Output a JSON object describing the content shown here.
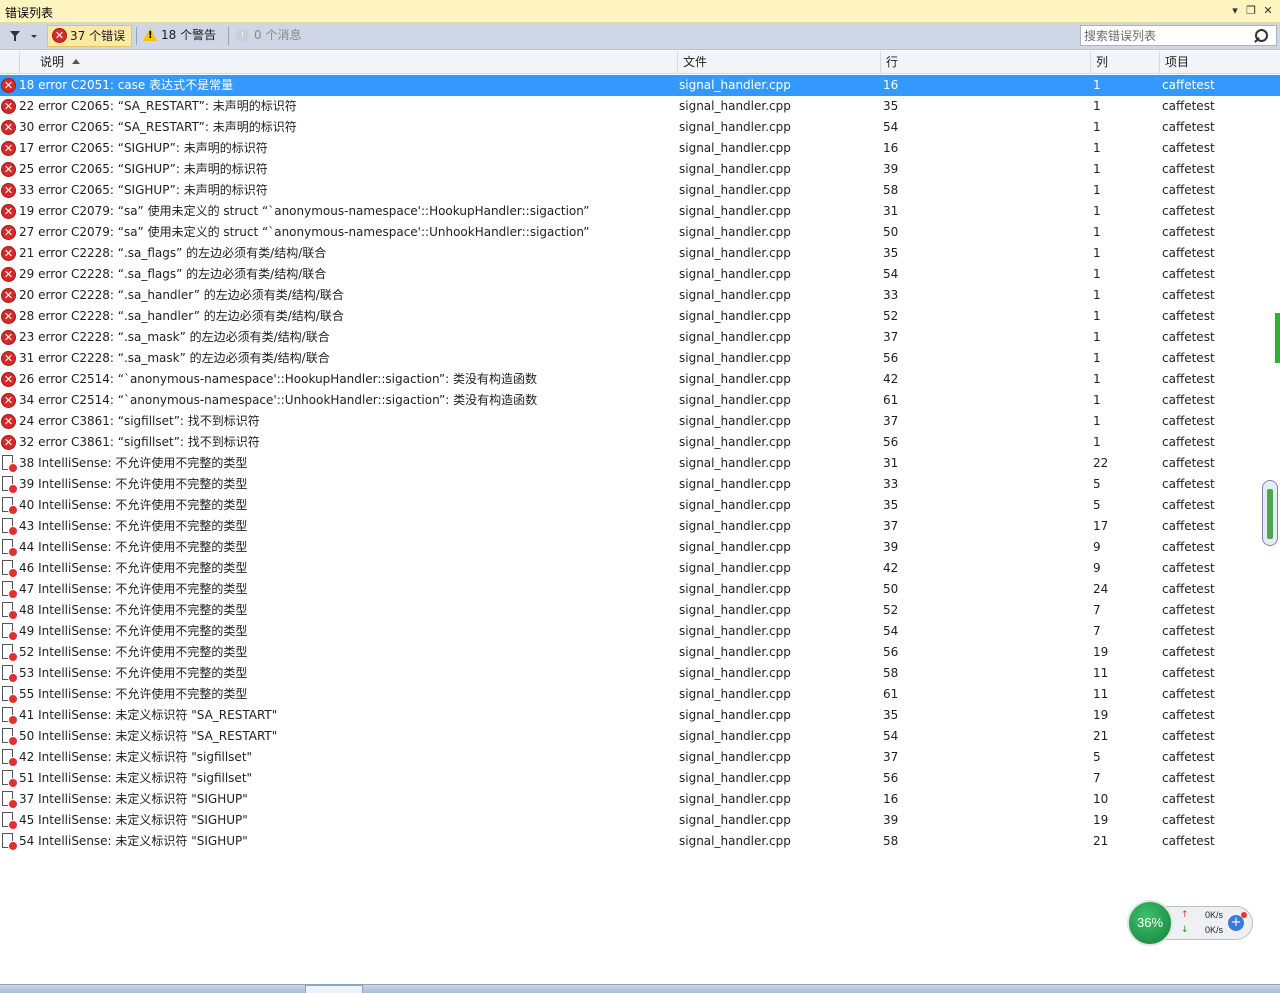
{
  "window": {
    "title": "错误列表"
  },
  "toolbar": {
    "errors_label": "37 个错误",
    "warnings_label": "18 个警告",
    "messages_label": "0 个消息",
    "search_placeholder": "搜索错误列表"
  },
  "columns": {
    "description": "说明",
    "file": "文件",
    "line": "行",
    "column": "列",
    "project": "项目"
  },
  "rows": [
    {
      "type": "error",
      "desc": "18 error C2051: case 表达式不是常量",
      "file": "signal_handler.cpp",
      "line": "16",
      "col": "1",
      "project": "caffetest"
    },
    {
      "type": "error",
      "desc": "22 error C2065: “SA_RESTART”: 未声明的标识符",
      "file": "signal_handler.cpp",
      "line": "35",
      "col": "1",
      "project": "caffetest"
    },
    {
      "type": "error",
      "desc": "30 error C2065: “SA_RESTART”: 未声明的标识符",
      "file": "signal_handler.cpp",
      "line": "54",
      "col": "1",
      "project": "caffetest"
    },
    {
      "type": "error",
      "desc": "17 error C2065: “SIGHUP”: 未声明的标识符",
      "file": "signal_handler.cpp",
      "line": "16",
      "col": "1",
      "project": "caffetest"
    },
    {
      "type": "error",
      "desc": "25 error C2065: “SIGHUP”: 未声明的标识符",
      "file": "signal_handler.cpp",
      "line": "39",
      "col": "1",
      "project": "caffetest"
    },
    {
      "type": "error",
      "desc": "33 error C2065: “SIGHUP”: 未声明的标识符",
      "file": "signal_handler.cpp",
      "line": "58",
      "col": "1",
      "project": "caffetest"
    },
    {
      "type": "error",
      "desc": "19 error C2079: “sa” 使用未定义的 struct “`anonymous-namespace'::HookupHandler::sigaction”",
      "file": "signal_handler.cpp",
      "line": "31",
      "col": "1",
      "project": "caffetest"
    },
    {
      "type": "error",
      "desc": "27 error C2079: “sa” 使用未定义的 struct “`anonymous-namespace'::UnhookHandler::sigaction”",
      "file": "signal_handler.cpp",
      "line": "50",
      "col": "1",
      "project": "caffetest"
    },
    {
      "type": "error",
      "desc": "21 error C2228: “.sa_flags” 的左边必须有类/结构/联合",
      "file": "signal_handler.cpp",
      "line": "35",
      "col": "1",
      "project": "caffetest"
    },
    {
      "type": "error",
      "desc": "29 error C2228: “.sa_flags” 的左边必须有类/结构/联合",
      "file": "signal_handler.cpp",
      "line": "54",
      "col": "1",
      "project": "caffetest"
    },
    {
      "type": "error",
      "desc": "20 error C2228: “.sa_handler” 的左边必须有类/结构/联合",
      "file": "signal_handler.cpp",
      "line": "33",
      "col": "1",
      "project": "caffetest"
    },
    {
      "type": "error",
      "desc": "28 error C2228: “.sa_handler” 的左边必须有类/结构/联合",
      "file": "signal_handler.cpp",
      "line": "52",
      "col": "1",
      "project": "caffetest"
    },
    {
      "type": "error",
      "desc": "23 error C2228: “.sa_mask” 的左边必须有类/结构/联合",
      "file": "signal_handler.cpp",
      "line": "37",
      "col": "1",
      "project": "caffetest"
    },
    {
      "type": "error",
      "desc": "31 error C2228: “.sa_mask” 的左边必须有类/结构/联合",
      "file": "signal_handler.cpp",
      "line": "56",
      "col": "1",
      "project": "caffetest"
    },
    {
      "type": "error",
      "desc": "26 error C2514: “`anonymous-namespace'::HookupHandler::sigaction”: 类没有构造函数",
      "file": "signal_handler.cpp",
      "line": "42",
      "col": "1",
      "project": "caffetest"
    },
    {
      "type": "error",
      "desc": "34 error C2514: “`anonymous-namespace'::UnhookHandler::sigaction”: 类没有构造函数",
      "file": "signal_handler.cpp",
      "line": "61",
      "col": "1",
      "project": "caffetest"
    },
    {
      "type": "error",
      "desc": "24 error C3861: “sigfillset”: 找不到标识符",
      "file": "signal_handler.cpp",
      "line": "37",
      "col": "1",
      "project": "caffetest"
    },
    {
      "type": "error",
      "desc": "32 error C3861: “sigfillset”: 找不到标识符",
      "file": "signal_handler.cpp",
      "line": "56",
      "col": "1",
      "project": "caffetest"
    },
    {
      "type": "intellisense",
      "desc": "38 IntelliSense: 不允许使用不完整的类型",
      "file": "signal_handler.cpp",
      "line": "31",
      "col": "22",
      "project": "caffetest"
    },
    {
      "type": "intellisense",
      "desc": "39 IntelliSense: 不允许使用不完整的类型",
      "file": "signal_handler.cpp",
      "line": "33",
      "col": "5",
      "project": "caffetest"
    },
    {
      "type": "intellisense",
      "desc": "40 IntelliSense: 不允许使用不完整的类型",
      "file": "signal_handler.cpp",
      "line": "35",
      "col": "5",
      "project": "caffetest"
    },
    {
      "type": "intellisense",
      "desc": "43 IntelliSense: 不允许使用不完整的类型",
      "file": "signal_handler.cpp",
      "line": "37",
      "col": "17",
      "project": "caffetest"
    },
    {
      "type": "intellisense",
      "desc": "44 IntelliSense: 不允许使用不完整的类型",
      "file": "signal_handler.cpp",
      "line": "39",
      "col": "9",
      "project": "caffetest"
    },
    {
      "type": "intellisense",
      "desc": "46 IntelliSense: 不允许使用不完整的类型",
      "file": "signal_handler.cpp",
      "line": "42",
      "col": "9",
      "project": "caffetest"
    },
    {
      "type": "intellisense",
      "desc": "47 IntelliSense: 不允许使用不完整的类型",
      "file": "signal_handler.cpp",
      "line": "50",
      "col": "24",
      "project": "caffetest"
    },
    {
      "type": "intellisense",
      "desc": "48 IntelliSense: 不允许使用不完整的类型",
      "file": "signal_handler.cpp",
      "line": "52",
      "col": "7",
      "project": "caffetest"
    },
    {
      "type": "intellisense",
      "desc": "49 IntelliSense: 不允许使用不完整的类型",
      "file": "signal_handler.cpp",
      "line": "54",
      "col": "7",
      "project": "caffetest"
    },
    {
      "type": "intellisense",
      "desc": "52 IntelliSense: 不允许使用不完整的类型",
      "file": "signal_handler.cpp",
      "line": "56",
      "col": "19",
      "project": "caffetest"
    },
    {
      "type": "intellisense",
      "desc": "53 IntelliSense: 不允许使用不完整的类型",
      "file": "signal_handler.cpp",
      "line": "58",
      "col": "11",
      "project": "caffetest"
    },
    {
      "type": "intellisense",
      "desc": "55 IntelliSense: 不允许使用不完整的类型",
      "file": "signal_handler.cpp",
      "line": "61",
      "col": "11",
      "project": "caffetest"
    },
    {
      "type": "intellisense",
      "desc": "41 IntelliSense: 未定义标识符 \"SA_RESTART\"",
      "file": "signal_handler.cpp",
      "line": "35",
      "col": "19",
      "project": "caffetest"
    },
    {
      "type": "intellisense",
      "desc": "50 IntelliSense: 未定义标识符 \"SA_RESTART\"",
      "file": "signal_handler.cpp",
      "line": "54",
      "col": "21",
      "project": "caffetest"
    },
    {
      "type": "intellisense",
      "desc": "42 IntelliSense: 未定义标识符 \"sigfillset\"",
      "file": "signal_handler.cpp",
      "line": "37",
      "col": "5",
      "project": "caffetest"
    },
    {
      "type": "intellisense",
      "desc": "51 IntelliSense: 未定义标识符 \"sigfillset\"",
      "file": "signal_handler.cpp",
      "line": "56",
      "col": "7",
      "project": "caffetest"
    },
    {
      "type": "intellisense",
      "desc": "37 IntelliSense: 未定义标识符 \"SIGHUP\"",
      "file": "signal_handler.cpp",
      "line": "16",
      "col": "10",
      "project": "caffetest"
    },
    {
      "type": "intellisense",
      "desc": "45 IntelliSense: 未定义标识符 \"SIGHUP\"",
      "file": "signal_handler.cpp",
      "line": "39",
      "col": "19",
      "project": "caffetest"
    },
    {
      "type": "intellisense",
      "desc": "54 IntelliSense: 未定义标识符 \"SIGHUP\"",
      "file": "signal_handler.cpp",
      "line": "58",
      "col": "21",
      "project": "caffetest"
    }
  ],
  "selected_row": 0,
  "net_widget": {
    "percent": "36%",
    "upload": "0K/s",
    "download": "0K/s"
  },
  "colors": {
    "selection": "#3399ff",
    "error": "#d62a2a",
    "titlebar": "#fdf4bf",
    "toolbar": "#cfd6e5"
  }
}
